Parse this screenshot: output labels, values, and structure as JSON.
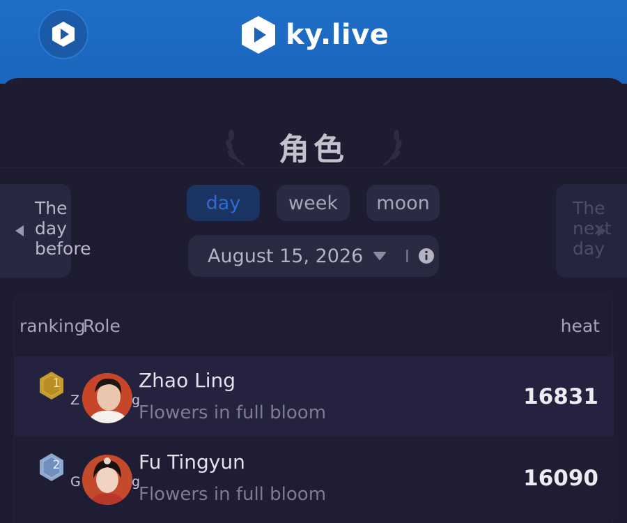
{
  "header": {
    "brand": "ky.live",
    "accent": "#1b65bd"
  },
  "page": {
    "title": "角色"
  },
  "tabs": [
    {
      "label": "day",
      "active": true
    },
    {
      "label": "week",
      "active": false
    },
    {
      "label": "moon",
      "active": false
    }
  ],
  "date": {
    "value": "August 15, 2026"
  },
  "nav": {
    "prev_label": "The day before",
    "next_label": "The next day"
  },
  "table": {
    "headers": {
      "ranking": "ranking",
      "role": "Role",
      "heat": "heat"
    },
    "rows": [
      {
        "rank": "1",
        "under_text_a": "Z",
        "under_text_b": "g",
        "name": "Zhao Ling",
        "drama": "Flowers in full bloom",
        "heat": "16831",
        "badge_color": "#c69b2d"
      },
      {
        "rank": "2",
        "under_text_a": "G",
        "under_text_b": "g",
        "name": "Fu Tingyun",
        "drama": "Flowers in full bloom",
        "heat": "16090",
        "badge_color": "#6f8fbf"
      }
    ]
  },
  "watermark": "ky.live"
}
